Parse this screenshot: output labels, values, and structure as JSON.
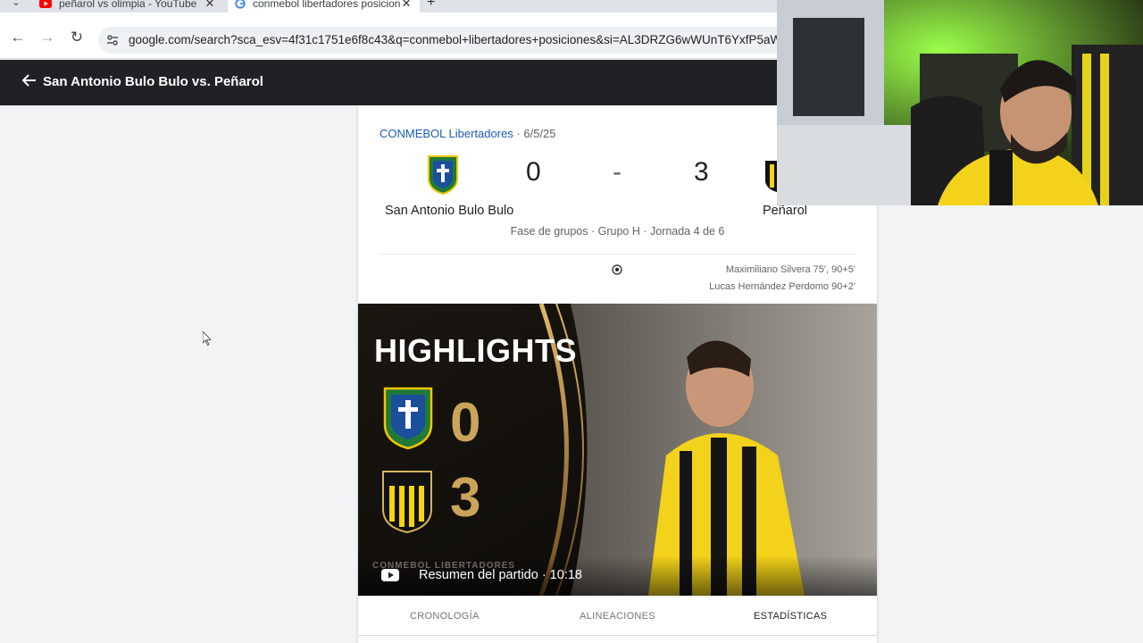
{
  "browser": {
    "tabs": [
      {
        "title": "peñarol vs olimpia - YouTube",
        "active": false,
        "favicon": "youtube-icon"
      },
      {
        "title": "conmebol libertadores posicion",
        "active": true,
        "favicon": "google-icon"
      }
    ],
    "url": "google.com/search?sca_esv=4f31c1751e6f8c43&q=conmebol+libertadores+posiciones&si=AL3DRZG6wWUnT6YxfP5aWEJYoodD"
  },
  "header": {
    "title": "San Antonio Bulo Bulo vs. Peñarol"
  },
  "match": {
    "competition": "CONMEBOL Libertadores",
    "date": "· 6/5/25",
    "home_team": "San Antonio Bulo Bulo",
    "away_team": "Peñarol",
    "home_score": "0",
    "separator": "-",
    "away_score": "3",
    "stage": "Fase de grupos · Grupo H · Jornada 4 de 6",
    "scorers": [
      "Maximiliano Silvera 75', 90+5'",
      "Lucas Hernández Perdomo 90+2'"
    ]
  },
  "video": {
    "overlay_title": "HIGHLIGHTS",
    "home_score": "0",
    "away_score": "3",
    "brand": "CONMEBOL LIBERTADORES",
    "caption": "Resumen del partido · 10:18"
  },
  "card_tabs": [
    {
      "label": "CRONOLOGÍA",
      "active": false
    },
    {
      "label": "ALINEACIONES",
      "active": false
    },
    {
      "label": "ESTADÍSTICAS",
      "active": true
    }
  ],
  "colors": {
    "header_bg": "#202124",
    "link": "#1a5cb5",
    "gold": "#cba45a",
    "penarol_yellow": "#f5d312"
  }
}
